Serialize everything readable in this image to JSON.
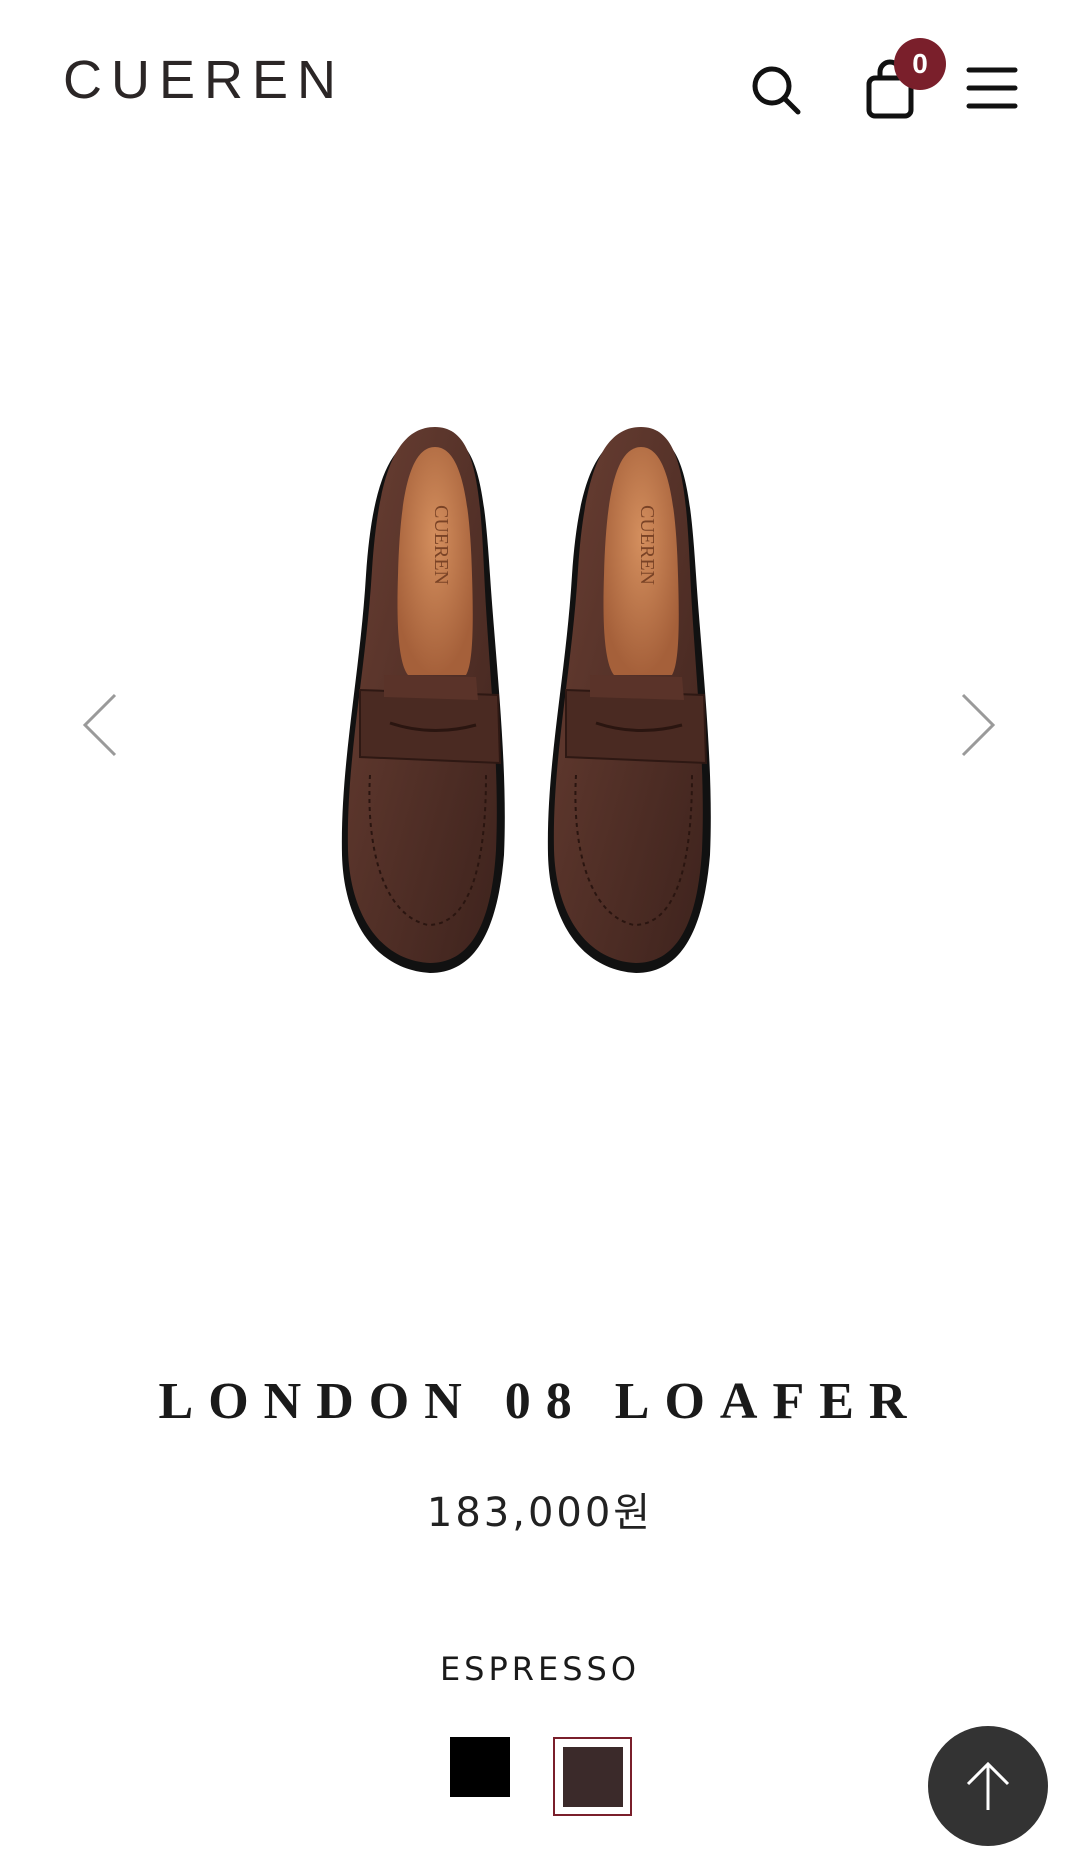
{
  "header": {
    "logo": "CUEREN",
    "cart_count": "0"
  },
  "product": {
    "name": "LONDON 08 LOAFER",
    "price": "183,000원",
    "selected_color": "ESPRESSO",
    "swatches": [
      {
        "name": "black",
        "color": "#000000"
      },
      {
        "name": "espresso",
        "color": "#3b2a2a"
      }
    ]
  },
  "icons": {
    "search": "search-icon",
    "cart": "shopping-bag-icon",
    "menu": "hamburger-menu-icon",
    "prev": "chevron-left-icon",
    "next": "chevron-right-icon",
    "top": "arrow-up-icon"
  },
  "colors": {
    "accent": "#7a1f2b",
    "text": "#1a1a1a",
    "scroll_top_bg": "#333333"
  }
}
